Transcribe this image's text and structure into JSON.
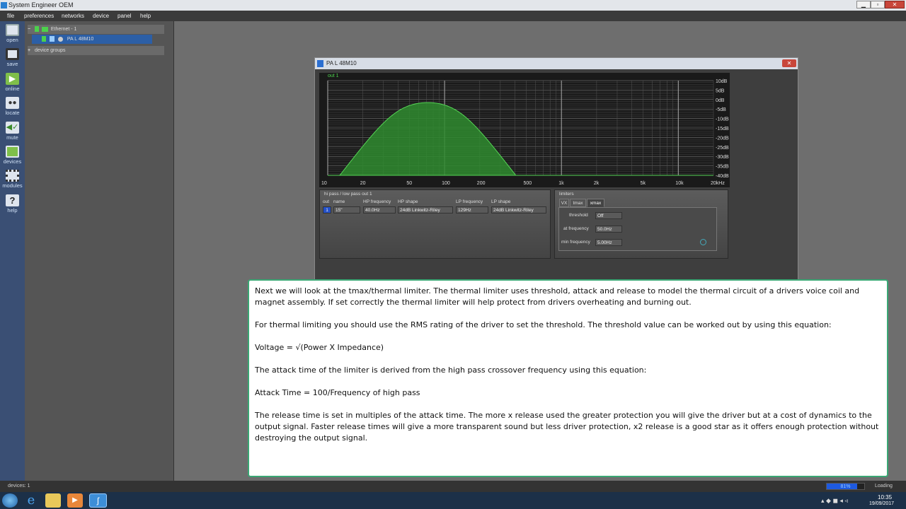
{
  "window": {
    "title": "System Engineer OEM"
  },
  "menu": [
    "file",
    "preferences",
    "networks",
    "device",
    "panel",
    "help"
  ],
  "toolbar": [
    {
      "label": "open",
      "icon": "folder-open-icon"
    },
    {
      "label": "save",
      "icon": "save-disk-icon"
    },
    {
      "label": "online",
      "icon": "play-icon"
    },
    {
      "label": "locate",
      "icon": "locate-icon"
    },
    {
      "label": "mute",
      "icon": "speaker-mute-icon"
    },
    {
      "label": "devices",
      "icon": "devices-icon"
    },
    {
      "label": "modules",
      "icon": "modules-icon"
    },
    {
      "label": "help",
      "icon": "question-icon"
    }
  ],
  "tree": {
    "network": "Ethernet - 1",
    "device": "PA L 48M10",
    "groups": "device groups"
  },
  "plugin": {
    "title": "PA L 48M10",
    "graph": {
      "series_label": "out 1",
      "db_ticks": [
        "10dB",
        "5dB",
        "0dB",
        "-5dB",
        "-10dB",
        "-15dB",
        "-20dB",
        "-25dB",
        "-30dB",
        "-35dB",
        "-40dB"
      ],
      "freq_ticks": [
        "10",
        "20",
        "50",
        "100",
        "200",
        "500",
        "1k",
        "2k",
        "5k",
        "10k",
        "20kHz"
      ]
    },
    "hipass": {
      "title": "hi pass / low pass out 1",
      "headers": {
        "out": "out",
        "name": "name",
        "hp_freq": "HP frequency",
        "hp_shape": "HP shape",
        "lp_freq": "LP frequency",
        "lp_shape": "LP shape"
      },
      "row": {
        "out": "1",
        "name": "15\"",
        "hp_freq": "40.0Hz",
        "hp_shape": "24dB Linkwitz-Riley",
        "lp_freq": "129Hz",
        "lp_shape": "24dB Linkwitz-Riley"
      }
    },
    "limiters": {
      "title": "limiters",
      "tabs": [
        "VX",
        "tmax",
        "xmax"
      ],
      "threshold_label": "threshold",
      "threshold": "Off",
      "at_freq_label": "at frequency",
      "at_freq": "50.0Hz",
      "min_freq_label": "min frequency",
      "min_freq": "5.00Hz"
    }
  },
  "info": {
    "p1": "Next we will look at the tmax/thermal limiter. The thermal limiter uses threshold, attack and release to model the thermal circuit of a drivers voice coil and magnet assembly. If set correctly the thermal limiter will help protect from drivers overheating and burning out.",
    "p2": "For thermal limiting you should use the RMS rating of the driver to set the threshold. The threshold value can be worked out by using this equation:",
    "p3": "Voltage = √(Power X Impedance)",
    "p4": "The attack time of the limiter is derived from the high pass crossover frequency using this equation:",
    "p5": "Attack Time = 100/Frequency of high pass",
    "p6": "The release time is set in multiples of the attack time. The more x release used the greater protection you will give the driver but at a cost of dynamics to the output signal. Faster release times will give a more transparent sound but less driver protection, x2 release is a good star as it offers enough protection without destroying the output signal."
  },
  "status": {
    "devices": "devices: 1",
    "progress": "81%",
    "progress_value": 0.81,
    "loading": "Loading"
  },
  "clock": {
    "time": "10:35",
    "date": "19/09/2017"
  }
}
